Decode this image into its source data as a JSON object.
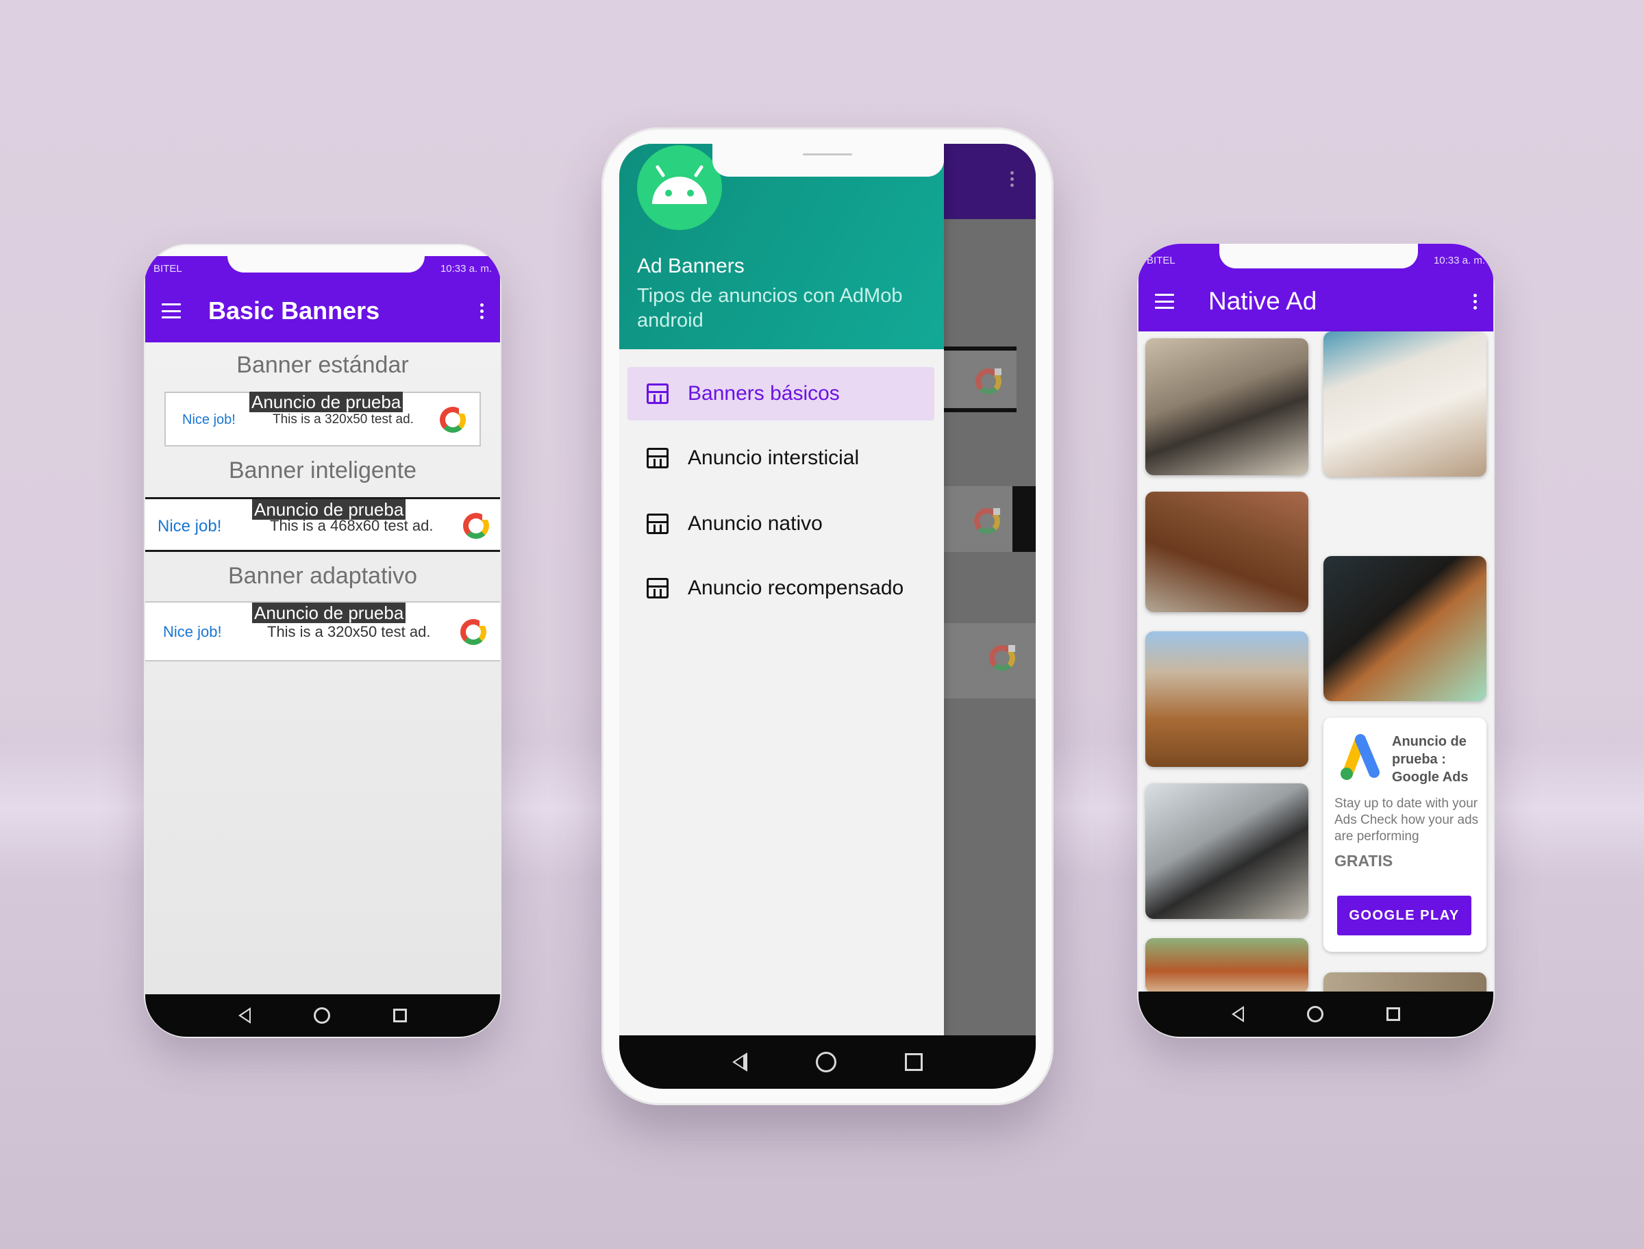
{
  "phone_left": {
    "status": {
      "carrier": "BITEL",
      "time": "10:33 a. m."
    },
    "title": "Basic Banners",
    "sections": [
      {
        "heading": "Banner estándar",
        "ad_tag": "Anuncio de prueba",
        "nice": "Nice job!",
        "text": "This is a 320x50 test ad."
      },
      {
        "heading": "Banner inteligente",
        "ad_tag": "Anuncio de prueba",
        "nice": "Nice job!",
        "text": "This is a 468x60 test ad."
      },
      {
        "heading": "Banner adaptativo",
        "ad_tag": "Anuncio de prueba",
        "nice": "Nice job!",
        "text": "This is a 320x50 test ad."
      }
    ]
  },
  "phone_center": {
    "header": {
      "title": "Ad Banners",
      "subtitle": "Tipos de anuncios con AdMob android"
    },
    "menu": [
      {
        "label": "Banners básicos",
        "icon": "store-icon",
        "active": true
      },
      {
        "label": "Anuncio intersticial",
        "icon": "store-icon",
        "active": false
      },
      {
        "label": "Anuncio nativo",
        "icon": "store-icon",
        "active": false
      },
      {
        "label": "Anuncio recompensado",
        "icon": "store-icon",
        "active": false
      }
    ]
  },
  "phone_right": {
    "status": {
      "carrier": "BITEL",
      "time": "10:33 a. m."
    },
    "title": "Native Ad",
    "native_ad": {
      "headline": "Anuncio de prueba : Google Ads",
      "body": "Stay up to date with your Ads Check how your ads are performing",
      "price": "GRATIS",
      "cta": "GOOGLE PLAY"
    }
  },
  "colors": {
    "primary": "#6a12e3",
    "primary_dark": "#4a1a8a",
    "drawer_header": "#0f9e8c",
    "active_item_bg": "#e9d9f3"
  }
}
